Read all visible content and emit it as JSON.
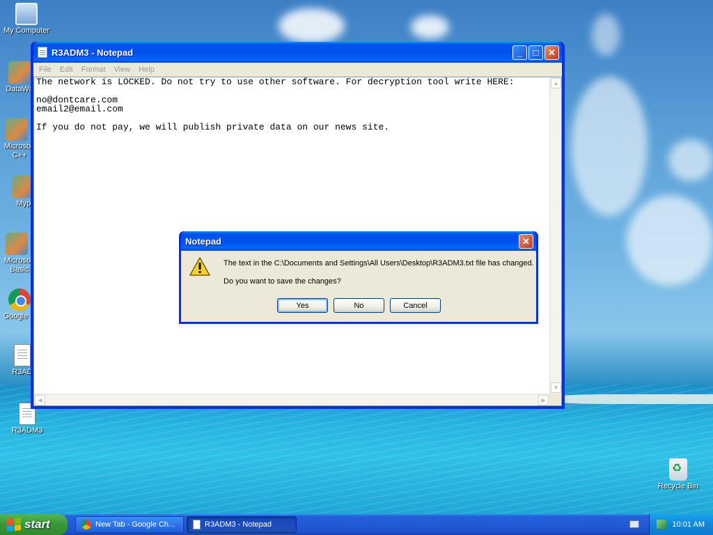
{
  "desktop": {
    "icons": [
      {
        "label": "My Computer",
        "icon": "computer-icon"
      },
      {
        "label": "DataWa",
        "icon": "shortcut-icon"
      },
      {
        "label": "Microsoft C++",
        "icon": "shortcut-icon"
      },
      {
        "label": "Myp",
        "icon": "shortcut-icon"
      },
      {
        "label": "Microsoft Basic",
        "icon": "shortcut-icon"
      },
      {
        "label": "Google C",
        "icon": "chrome-icon"
      },
      {
        "label": "R3AD",
        "icon": "text-document-icon"
      },
      {
        "label": "R3ADM3",
        "icon": "text-document-icon"
      },
      {
        "label": "Recycle Bin",
        "icon": "recycle-bin-icon"
      }
    ]
  },
  "notepad": {
    "title": "R3ADM3 - Notepad",
    "menu": [
      "File",
      "Edit",
      "Format",
      "View",
      "Help"
    ],
    "content": "The network is LOCKED. Do not try to use other software. For decryption tool write HERE:\n\nno@dontcare.com\nemail2@email.com\n\nIf you do not pay, we will publish private data on our news site."
  },
  "dialog": {
    "title": "Notepad",
    "message": "The text in the C:\\Documents and Settings\\All Users\\Desktop\\R3ADM3.txt file has changed.",
    "question": "Do you want to save the changes?",
    "buttons": {
      "yes": "Yes",
      "no": "No",
      "cancel": "Cancel"
    },
    "icon": "warning-icon"
  },
  "taskbar": {
    "start_label": "start",
    "tasks": [
      {
        "label": "New Tab - Google Ch...",
        "active": false,
        "icon": "chrome-icon"
      },
      {
        "label": "R3ADM3 - Notepad",
        "active": true,
        "icon": "notepad-icon"
      }
    ],
    "clock": "10:01 AM"
  },
  "colors": {
    "title_blue": "#0053ee",
    "taskbar_blue": "#245edb",
    "start_green": "#3a9a37"
  }
}
